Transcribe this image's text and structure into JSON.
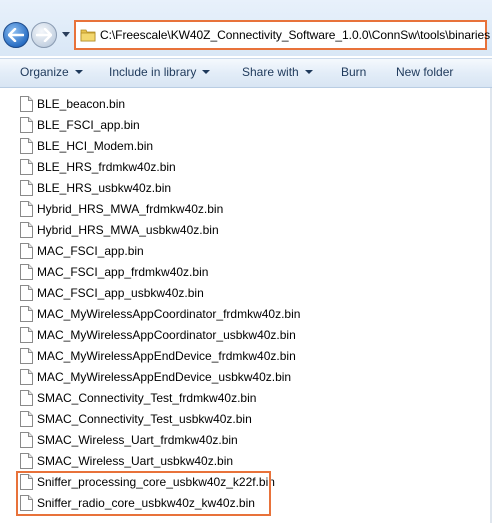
{
  "address_bar": {
    "path": "C:\\Freescale\\KW40Z_Connectivity_Software_1.0.0\\ConnSw\\tools\\binaries"
  },
  "toolbar": {
    "organize": "Organize",
    "include_in_library": "Include in library",
    "share_with": "Share with",
    "burn": "Burn",
    "new_folder": "New folder"
  },
  "files": [
    "BLE_beacon.bin",
    "BLE_FSCI_app.bin",
    "BLE_HCI_Modem.bin",
    "BLE_HRS_frdmkw40z.bin",
    "BLE_HRS_usbkw40z.bin",
    "Hybrid_HRS_MWA_frdmkw40z.bin",
    "Hybrid_HRS_MWA_usbkw40z.bin",
    "MAC_FSCI_app.bin",
    "MAC_FSCI_app_frdmkw40z.bin",
    "MAC_FSCI_app_usbkw40z.bin",
    "MAC_MyWirelessAppCoordinator_frdmkw40z.bin",
    "MAC_MyWirelessAppCoordinator_usbkw40z.bin",
    "MAC_MyWirelessAppEndDevice_frdmkw40z.bin",
    "MAC_MyWirelessAppEndDevice_usbkw40z.bin",
    "SMAC_Connectivity_Test_frdmkw40z.bin",
    "SMAC_Connectivity_Test_usbkw40z.bin",
    "SMAC_Wireless_Uart_frdmkw40z.bin",
    "SMAC_Wireless_Uart_usbkw40z.bin",
    "Sniffer_processing_core_usbkw40z_k22f.bin",
    "Sniffer_radio_core_usbkw40z_kw40z.bin"
  ],
  "icons": {
    "back": "back-arrow-icon",
    "forward": "forward-arrow-icon",
    "history": "chevron-down-icon",
    "folder": "folder-icon",
    "file": "file-icon"
  },
  "colors": {
    "highlight": "#e8723a",
    "toolbar_text": "#1e395b"
  }
}
